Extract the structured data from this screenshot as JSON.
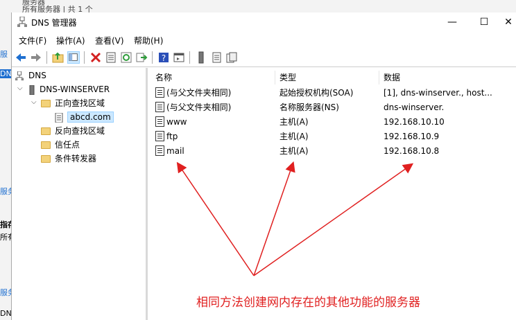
{
  "background": {
    "top_line1": "服务器",
    "top_line2": "所有服务器 | 共 1 个",
    "left_fragments": [
      "服",
      "DN",
      "服务",
      "指存",
      "所有",
      "服务",
      "DN"
    ]
  },
  "window": {
    "title": "DNS 管理器",
    "controls": {
      "minimize": "—",
      "maximize": "☐",
      "close": "✕"
    }
  },
  "menu": [
    "文件(F)",
    "操作(A)",
    "查看(V)",
    "帮助(H)"
  ],
  "toolbar": {
    "icons": [
      "back-icon",
      "forward-icon",
      "up-folder-icon",
      "show-tree-icon",
      "delete-icon",
      "properties-icon",
      "refresh-icon",
      "export-icon",
      "help-icon",
      "action-pane-icon",
      "server-icon",
      "zone-icon",
      "records-icon"
    ],
    "colors": {
      "back": "#1e6fd0",
      "delete": "#d32020",
      "refresh": "#2e9c3a",
      "help": "#2b4fb8"
    }
  },
  "tree": {
    "root": "DNS",
    "server": "DNS-WINSERVER",
    "forward_zones": "正向查找区域",
    "zone_selected": "abcd.com",
    "reverse_zones": "反向查找区域",
    "trust_points": "信任点",
    "conditional_forwarders": "条件转发器"
  },
  "table": {
    "headers": [
      "名称",
      "类型",
      "数据"
    ],
    "rows": [
      {
        "name": "(与父文件夹相同)",
        "type": "起始授权机构(SOA)",
        "data": "[1], dns-winserver., host..."
      },
      {
        "name": "(与父文件夹相同)",
        "type": "名称服务器(NS)",
        "data": "dns-winserver."
      },
      {
        "name": "www",
        "type": "主机(A)",
        "data": "192.168.10.10"
      },
      {
        "name": "ftp",
        "type": "主机(A)",
        "data": "192.168.10.9"
      },
      {
        "name": "mail",
        "type": "主机(A)",
        "data": "192.168.10.8"
      }
    ]
  },
  "annotation": {
    "text": "相同方法创建网内存在的其他功能的服务器",
    "color": "#e02020"
  }
}
